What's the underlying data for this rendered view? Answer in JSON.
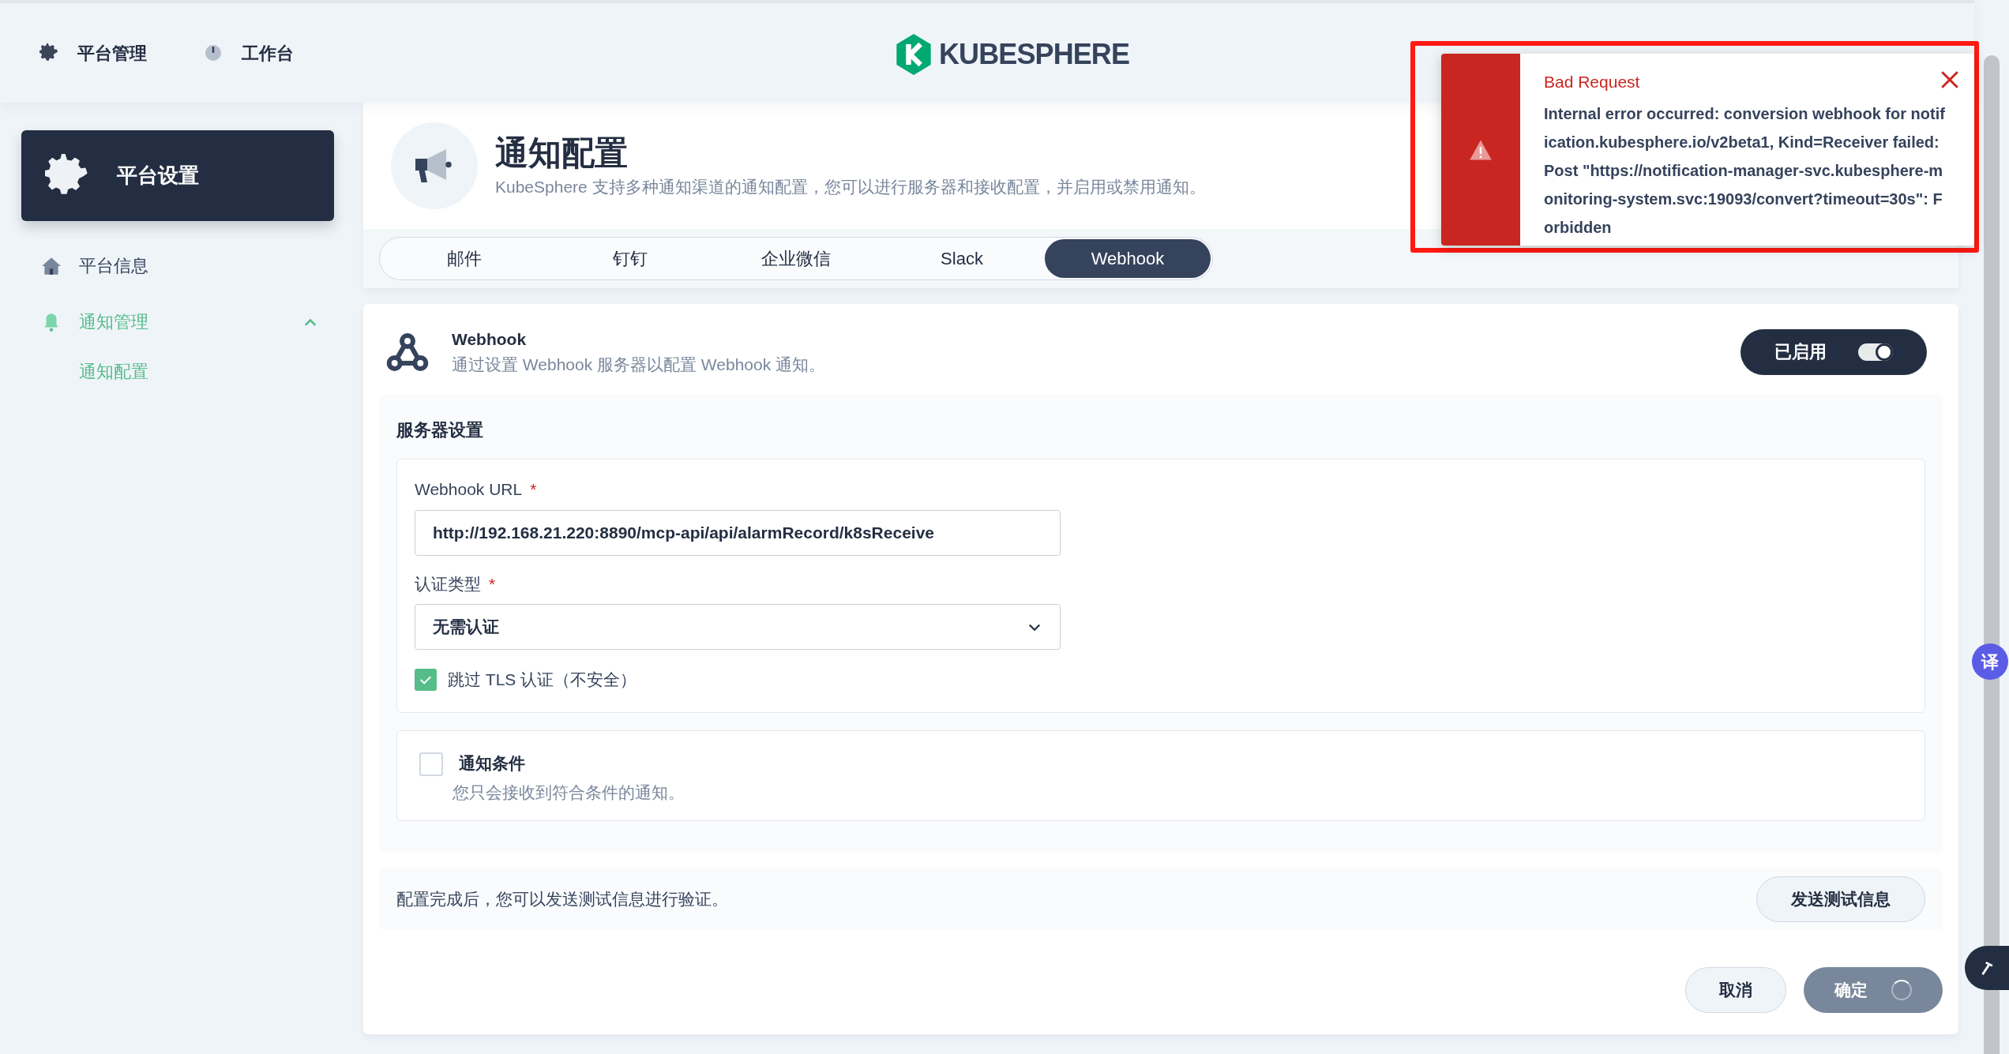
{
  "header": {
    "nav": [
      {
        "label": "平台管理",
        "kind": "gear"
      },
      {
        "label": "工作台",
        "kind": "dial"
      }
    ],
    "logo": "KUBESPHERE"
  },
  "sidebar": {
    "title": "平台设置",
    "items": [
      {
        "label": "平台信息",
        "kind": "home",
        "selected": false
      },
      {
        "label": "通知管理",
        "kind": "bell",
        "selected": true,
        "expanded": true,
        "children": [
          {
            "label": "通知配置",
            "selected": true
          }
        ]
      }
    ]
  },
  "page": {
    "title": "通知配置",
    "description": "KubeSphere 支持多种通知渠道的通知配置，您可以进行服务器和接收配置，并启用或禁用通知。"
  },
  "tabs": [
    {
      "label": "邮件",
      "selected": false
    },
    {
      "label": "钉钉",
      "selected": false
    },
    {
      "label": "企业微信",
      "selected": false
    },
    {
      "label": "Slack",
      "selected": false
    },
    {
      "label": "Webhook",
      "selected": true
    }
  ],
  "card": {
    "title": "Webhook",
    "description": "通过设置 Webhook 服务器以配置 Webhook 通知。",
    "toggle": {
      "label": "已启用",
      "on": true
    }
  },
  "server_settings": {
    "title": "服务器设置",
    "url_field": {
      "label": "Webhook URL",
      "required_mark": "*",
      "value": "http://192.168.21.220:8890/mcp-api/api/alarmRecord/k8sReceive"
    },
    "auth_field": {
      "label": "认证类型",
      "required_mark": "*",
      "value": "无需认证"
    },
    "skip_tls": {
      "label": "跳过 TLS 认证（不安全）",
      "checked": true
    }
  },
  "conditions": {
    "label": "通知条件",
    "description": "您只会接收到符合条件的通知。",
    "checked": false
  },
  "test": {
    "text": "配置完成后，您可以发送测试信息进行验证。",
    "button": "发送测试信息"
  },
  "footer": {
    "cancel": "取消",
    "confirm": {
      "label": "确定",
      "loading": true
    }
  },
  "toast": {
    "title": "Bad Request",
    "message": "Internal error occurred: conversion webhook for notification.kubesphere.io/v2beta1, Kind=Receiver failed: Post \"https://notification-manager-svc.kubesphere-monitoring-system.svc:19093/convert?timeout=30s\": Forbidden"
  },
  "translate_button": "译"
}
